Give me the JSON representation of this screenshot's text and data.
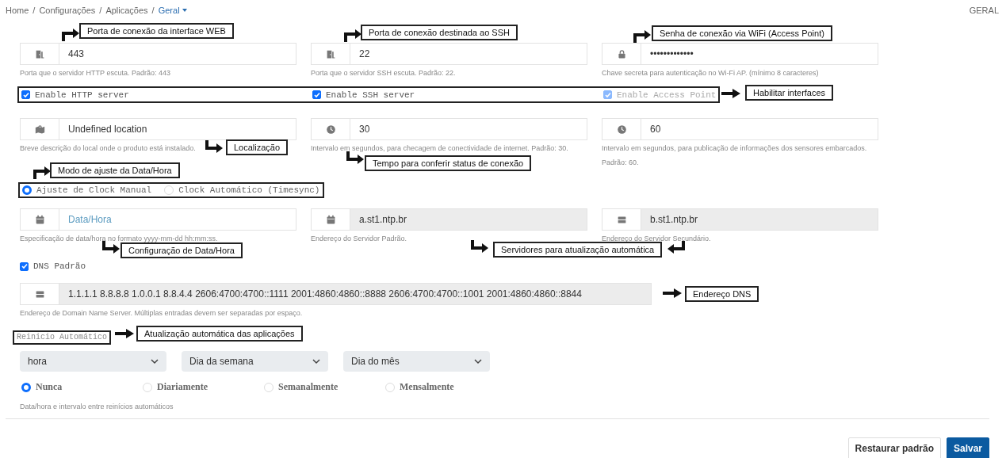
{
  "breadcrumb": {
    "separator": "/",
    "items": [
      {
        "label": "Home",
        "current": false,
        "dropdown": false
      },
      {
        "label": "Configurações",
        "current": false,
        "dropdown": false
      },
      {
        "label": "Aplicações",
        "current": false,
        "dropdown": false
      },
      {
        "label": "Geral",
        "current": true,
        "dropdown": true
      }
    ]
  },
  "page_label": "GERAL",
  "network_fields": [
    {
      "kind": "door",
      "value": "443",
      "disabled": false,
      "help": [
        "Porta que o servidor HTTP escuta. Padrão: 443"
      ]
    },
    {
      "kind": "door",
      "value": "22",
      "disabled": false,
      "help": [
        "Porta que o servidor SSH escuta. Padrão: 22."
      ]
    },
    {
      "kind": "lock",
      "value": "•••••••••••••",
      "disabled": false,
      "help": [
        "Chave secreta para autenticação no Wi-Fi AP. (mínimo 8 caracteres)"
      ]
    }
  ],
  "interfaces": [
    {
      "label": "Enable HTTP server",
      "checked": true,
      "disabled": false
    },
    {
      "label": "Enable SSH server",
      "checked": true,
      "disabled": false
    },
    {
      "label": "Enable Access Point",
      "checked": true,
      "disabled": true
    }
  ],
  "interval_fields": [
    {
      "kind": "map",
      "value": "Undefined location",
      "disabled": false,
      "help": [
        "Breve descrição do local onde o produto está instalado."
      ]
    },
    {
      "kind": "clock",
      "value": "30",
      "disabled": false,
      "help": [
        "Intervalo em segundos, para checagem de conectividade de internet. Padrão: 30."
      ]
    },
    {
      "kind": "clock",
      "value": "60",
      "disabled": false,
      "help": [
        "Intervalo em segundos, para publicação de informações dos sensores embarcados.",
        "Padrão: 60."
      ]
    }
  ],
  "clock_mode": [
    {
      "label": "Ajuste de Clock Manual",
      "selected": true
    },
    {
      "label": "Clock Automático (Timesync)",
      "selected": false
    }
  ],
  "time_fields": [
    {
      "kind": "calendar",
      "placeholder": "Data/Hora",
      "disabled": false,
      "help": [
        "Especificação de data/hora no formato yyyy-mm-dd hh:mm:ss."
      ]
    },
    {
      "kind": "calendar",
      "value": "a.st1.ntp.br",
      "disabled": true,
      "help": [
        "Endereço do Servidor Padrão."
      ]
    },
    {
      "kind": "server",
      "value": "b.st1.ntp.br",
      "disabled": true,
      "help": [
        "Endereço do Servidor Secundário."
      ]
    }
  ],
  "dns": {
    "checkbox": {
      "label": "DNS Padrão",
      "checked": true,
      "disabled": false
    },
    "field": {
      "kind": "server",
      "value": "1.1.1.1 8.8.8.8 1.0.0.1 8.8.4.4 2606:4700:4700::1111 2001:4860:4860::8888 2606:4700:4700::1001 2001:4860:4860::8844",
      "disabled": true,
      "help": [
        "Endereço de Domain Name Server. Múltiplas entradas devem ser separadas por espaço."
      ]
    }
  },
  "restart": {
    "label": "Reinicio Automático",
    "selects": [
      "hora",
      "Dia da semana",
      "Dia do mês"
    ],
    "frequency": [
      {
        "label": "Nunca",
        "selected": true
      },
      {
        "label": "Diariamente",
        "selected": false
      },
      {
        "label": "Semanalmente",
        "selected": false
      },
      {
        "label": "Mensalmente",
        "selected": false
      }
    ],
    "help": "Data/hora e intervalo entre reinícios automáticos"
  },
  "buttons": [
    {
      "label": "Restaurar padrão",
      "kind": "secondary"
    },
    {
      "label": "Salvar",
      "kind": "primary"
    }
  ],
  "annotations": [
    {
      "text": "Porta de conexão da interface WEB",
      "arrows": [
        {
          "kind": "up-right"
        }
      ]
    },
    {
      "text": "Porta de conexão destinada ao SSH",
      "arrows": [
        {
          "kind": "up-right"
        }
      ]
    },
    {
      "text": "Senha de conexão via WiFi (Access Point)",
      "arrows": [
        {
          "kind": "up-right"
        }
      ]
    },
    {
      "text": "Habilitar interfaces",
      "arrows": [
        {
          "kind": "right"
        }
      ]
    },
    {
      "text": "Localização",
      "arrows": [
        {
          "kind": "down-right"
        }
      ]
    },
    {
      "text": "Tempo para conferir status de conexão",
      "arrows": [
        {
          "kind": "down-right"
        }
      ]
    },
    {
      "text": "Modo de ajuste da Data/Hora",
      "arrows": [
        {
          "kind": "up-right"
        }
      ]
    },
    {
      "text": "Configuração de Data/Hora",
      "arrows": [
        {
          "kind": "down-right"
        }
      ]
    },
    {
      "text": "Servidores para atualização automática",
      "arrows": [
        {
          "kind": "down-right"
        },
        {
          "kind": "down-left"
        }
      ]
    },
    {
      "text": "Endereço DNS",
      "arrows": [
        {
          "kind": "right"
        }
      ]
    },
    {
      "text": "Atualização automática das aplicações",
      "arrows": [
        {
          "kind": "right"
        }
      ]
    }
  ]
}
